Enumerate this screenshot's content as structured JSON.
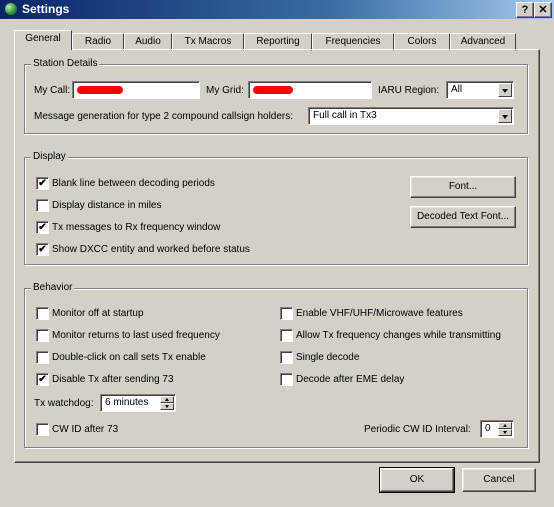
{
  "window": {
    "title": "Settings",
    "help_label": "?",
    "close_label": "✕"
  },
  "tabs": [
    {
      "label": "General",
      "active": true
    },
    {
      "label": "Radio"
    },
    {
      "label": "Audio"
    },
    {
      "label": "Tx Macros"
    },
    {
      "label": "Reporting"
    },
    {
      "label": "Frequencies"
    },
    {
      "label": "Colors"
    },
    {
      "label": "Advanced"
    }
  ],
  "station": {
    "group_title": "Station Details",
    "my_call_label": "My Call:",
    "my_grid_label": "My Grid:",
    "iaru_label": "IARU Region:",
    "iaru_value": "All",
    "msg_gen_label": "Message generation for type 2 compound callsign holders:",
    "msg_gen_value": "Full call in Tx3"
  },
  "display": {
    "group_title": "Display",
    "options": [
      {
        "label": "Blank line between decoding periods",
        "checked": true
      },
      {
        "label": "Display distance in miles",
        "checked": false
      },
      {
        "label": "Tx messages to Rx frequency window",
        "checked": true
      },
      {
        "label": "Show DXCC entity and worked before status",
        "checked": true
      }
    ],
    "font_button": "Font...",
    "decoded_font_button": "Decoded Text Font..."
  },
  "behavior": {
    "group_title": "Behavior",
    "left_options": [
      {
        "label": "Monitor off at startup",
        "checked": false
      },
      {
        "label": "Monitor returns to last used frequency",
        "checked": false
      },
      {
        "label": "Double-click on call sets Tx enable",
        "checked": false
      },
      {
        "label": "Disable Tx after sending 73",
        "checked": true
      }
    ],
    "right_options": [
      {
        "label": "Enable VHF/UHF/Microwave features",
        "checked": false
      },
      {
        "label": "Allow Tx frequency changes while transmitting",
        "checked": false
      },
      {
        "label": "Single decode",
        "checked": false
      },
      {
        "label": "Decode after EME delay",
        "checked": false
      }
    ],
    "watchdog_label": "Tx watchdog:",
    "watchdog_value": "6 minutes",
    "cwid_label": "CW ID after 73",
    "cwid_checked": false,
    "periodic_label": "Periodic CW ID Interval:",
    "periodic_value": "0"
  },
  "footer": {
    "ok_label": "OK",
    "cancel_label": "Cancel"
  }
}
